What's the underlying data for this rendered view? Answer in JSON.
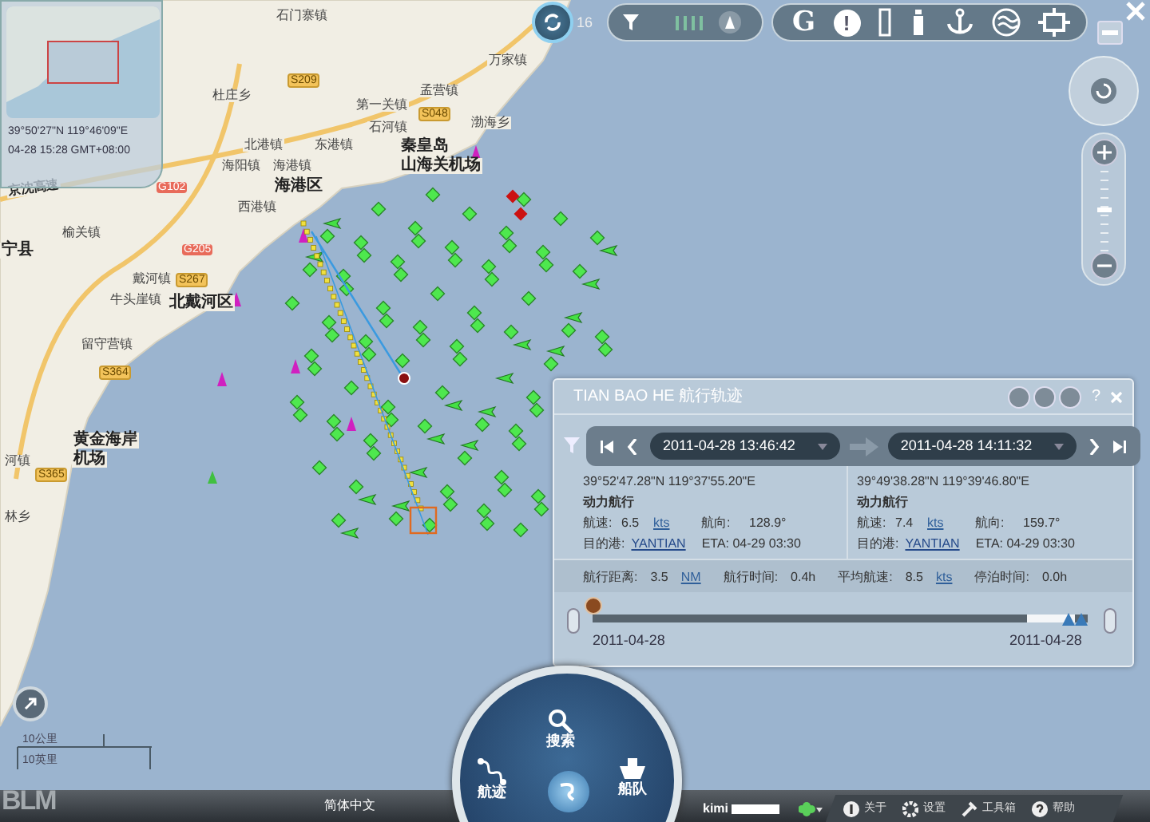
{
  "minimap": {
    "coords": "39°50'27\"N 119°46'09\"E",
    "time": "04-28 15:28 GMT+08:00"
  },
  "top_toolbar": {
    "zoom_level": "16",
    "right_group": [
      {
        "kind": "glyph",
        "label": "G"
      },
      {
        "kind": "circle_glyph",
        "label": "!"
      },
      {
        "kind": "bar"
      },
      {
        "kind": "lighthouse"
      },
      {
        "kind": "anchor"
      },
      {
        "kind": "waves"
      },
      {
        "kind": "frame"
      }
    ]
  },
  "zoom_control": {
    "level": 0.52
  },
  "map_labels": [
    {
      "text": "石门寨镇",
      "kind": "place"
    },
    {
      "text": "S209",
      "kind": "road"
    },
    {
      "text": "杜庄乡",
      "kind": "place"
    },
    {
      "text": "第一关镇",
      "kind": "place"
    },
    {
      "text": "孟营镇",
      "kind": "place"
    },
    {
      "text": "万家镇",
      "kind": "place"
    },
    {
      "text": "S048",
      "kind": "road"
    },
    {
      "text": "石河镇",
      "kind": "place"
    },
    {
      "text": "渤海乡",
      "kind": "place"
    },
    {
      "text": "秦皇岛",
      "kind": "major"
    },
    {
      "text": "山海关机场",
      "kind": "major"
    },
    {
      "text": "北港镇",
      "kind": "place"
    },
    {
      "text": "东港镇",
      "kind": "place"
    },
    {
      "text": "海阳镇",
      "kind": "place"
    },
    {
      "text": "海港镇",
      "kind": "place"
    },
    {
      "text": "海港区",
      "kind": "major"
    },
    {
      "text": "西港镇",
      "kind": "place"
    },
    {
      "text": "京沈高速",
      "kind": "highway"
    },
    {
      "text": "G102",
      "kind": "national"
    },
    {
      "text": "榆关镇",
      "kind": "place"
    },
    {
      "text": "宁县",
      "kind": "major"
    },
    {
      "text": "G205",
      "kind": "national"
    },
    {
      "text": "戴河镇",
      "kind": "place"
    },
    {
      "text": "S267",
      "kind": "road"
    },
    {
      "text": "牛头崖镇",
      "kind": "place"
    },
    {
      "text": "北戴河区",
      "kind": "major"
    },
    {
      "text": "留守营镇",
      "kind": "place"
    },
    {
      "text": "S364",
      "kind": "road"
    },
    {
      "text": "黄金海岸",
      "kind": "major"
    },
    {
      "text": "机场",
      "kind": "major"
    },
    {
      "text": "河镇",
      "kind": "place"
    },
    {
      "text": "S365",
      "kind": "road"
    },
    {
      "text": "林乡",
      "kind": "place"
    }
  ],
  "track_panel": {
    "title": "TIAN BAO HE 航行轨迹",
    "help": "?",
    "start_time": "2011-04-28 13:46:42",
    "end_time": "2011-04-28 14:11:32",
    "points": [
      {
        "coords": "39°52'47.28\"N 119°37'55.20\"E",
        "status": "动力航行",
        "speed_label": "航速:",
        "speed": "6.5",
        "speed_unit": "kts",
        "course_label": "航向:",
        "course": "128.9°",
        "dest_label": "目的港:",
        "dest": "YANTIAN",
        "eta": "ETA: 04-29 03:30"
      },
      {
        "coords": "39°49'38.28\"N 119°39'46.80\"E",
        "status": "动力航行",
        "speed_label": "航速:",
        "speed": "7.4",
        "speed_unit": "kts",
        "course_label": "航向:",
        "course": "159.7°",
        "dest_label": "目的港:",
        "dest": "YANTIAN",
        "eta": "ETA: 04-29 03:30"
      }
    ],
    "summary": [
      {
        "label": "航行距离:",
        "value": "3.5",
        "unit": "NM"
      },
      {
        "label": "航行时间:",
        "value": "0.4h"
      },
      {
        "label": "平均航速:",
        "value": "8.5",
        "unit": "kts"
      },
      {
        "label": "停泊时间:",
        "value": "0.0h"
      }
    ],
    "timeline": {
      "start_label": "2011-04-28",
      "end_label": "2011-04-28",
      "level": 0
    }
  },
  "scale": {
    "metric": "10公里",
    "imperial": "10英里"
  },
  "hub": {
    "search": "搜索",
    "track": "航迹",
    "fleet": "船队"
  },
  "bottom_bar": {
    "logo": "BLM",
    "language": "简体中文",
    "user": "kimi",
    "menu": [
      "关于",
      "设置",
      "工具箱",
      "帮助"
    ]
  }
}
